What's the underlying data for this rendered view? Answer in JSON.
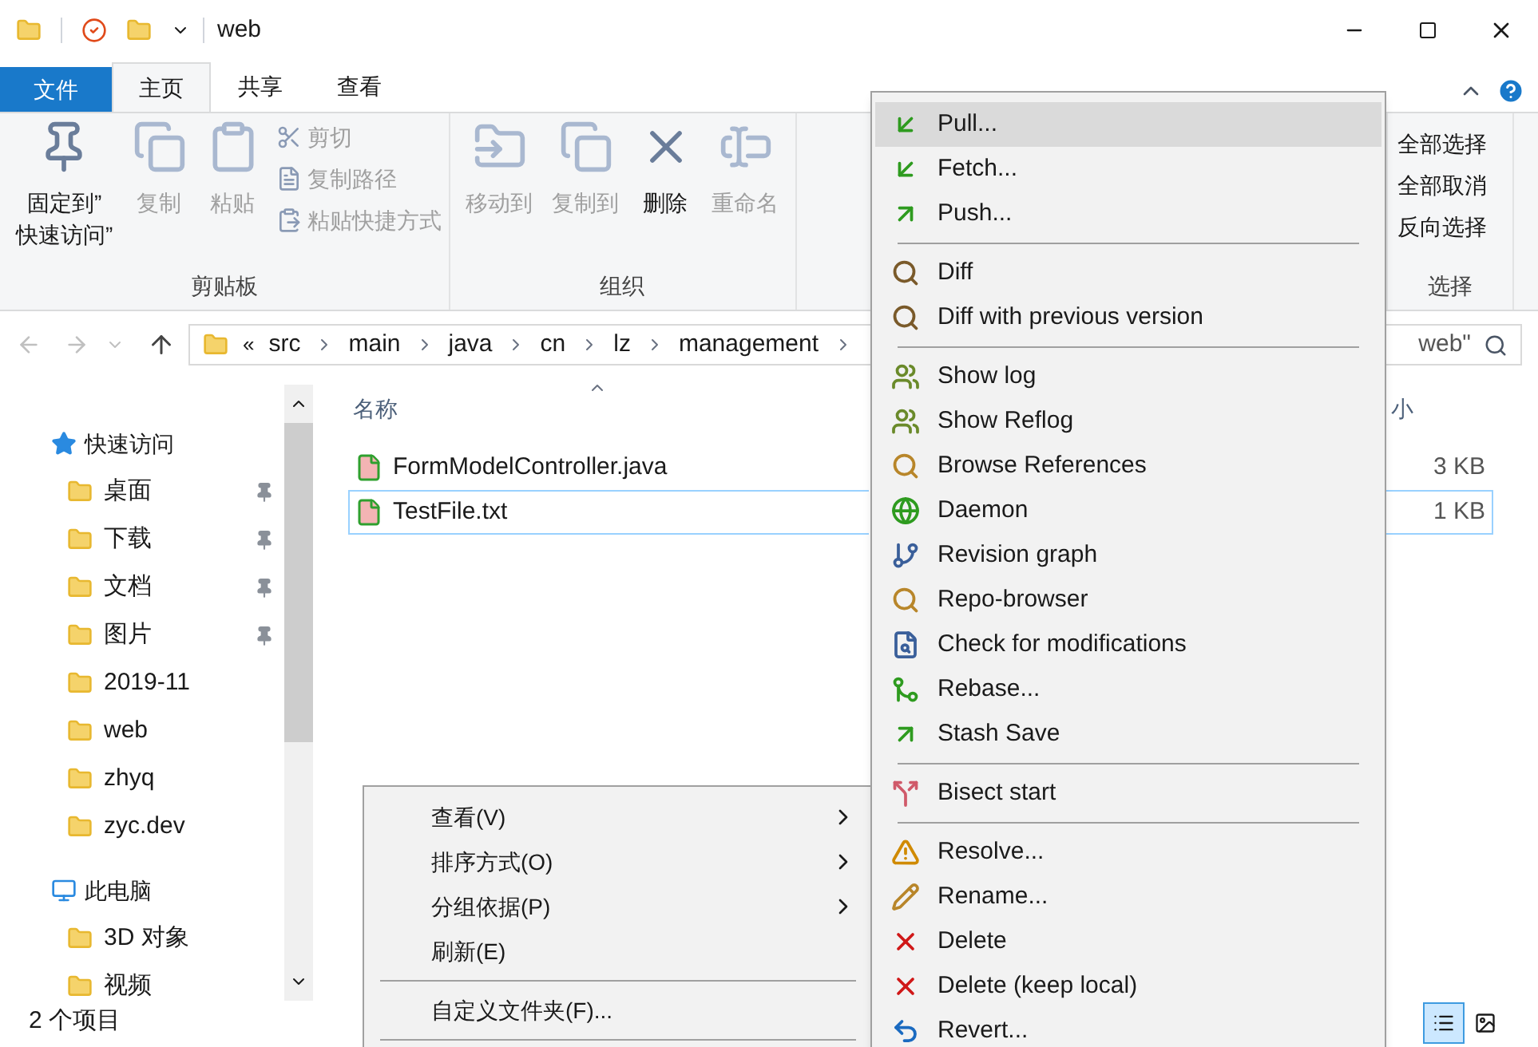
{
  "window": {
    "title": "web"
  },
  "ribbon_tabs": [
    {
      "label": "文件",
      "kind": "file",
      "selected": false
    },
    {
      "label": "主页",
      "kind": "tab",
      "selected": true
    },
    {
      "label": "共享",
      "kind": "tab",
      "selected": false
    },
    {
      "label": "查看",
      "kind": "tab",
      "selected": false
    }
  ],
  "ribbon_groups": [
    {
      "label": "剪贴板",
      "large": [
        {
          "label": "固定到”\n快速访问”",
          "disabled": false
        },
        {
          "label": "复制",
          "disabled": true
        },
        {
          "label": "粘贴",
          "disabled": true
        }
      ],
      "small": [
        {
          "label": "剪切",
          "disabled": true
        },
        {
          "label": "复制路径",
          "disabled": true
        },
        {
          "label": "粘贴快捷方式",
          "disabled": true
        }
      ]
    },
    {
      "label": "组织",
      "large": [
        {
          "label": "移动到",
          "disabled": true
        },
        {
          "label": "复制到",
          "disabled": true
        },
        {
          "label": "删除",
          "disabled": false
        },
        {
          "label": "重命名",
          "disabled": true
        }
      ]
    }
  ],
  "selection_group": {
    "label": "选择",
    "items": [
      "全部选择",
      "全部取消",
      "反向选择"
    ]
  },
  "address_bar": {
    "overflow": "«",
    "crumbs": [
      "src",
      "main",
      "java",
      "cn",
      "lz",
      "management"
    ]
  },
  "search": {
    "value": "web\""
  },
  "nav_pane": [
    {
      "label": "快速访问",
      "children": [
        {
          "label": "桌面",
          "pinned": true
        },
        {
          "label": "下载",
          "pinned": true
        },
        {
          "label": "文档",
          "pinned": true
        },
        {
          "label": "图片",
          "pinned": true
        },
        {
          "label": "2019-11",
          "pinned": false
        },
        {
          "label": "web",
          "pinned": false
        },
        {
          "label": "zhyq",
          "pinned": false
        },
        {
          "label": "zyc.dev",
          "pinned": false
        }
      ]
    },
    {
      "label": "此电脑",
      "children": [
        {
          "label": "3D 对象",
          "pinned": false
        },
        {
          "label": "视频",
          "pinned": false
        }
      ]
    }
  ],
  "file_list": {
    "columns": [
      "名称",
      "小"
    ],
    "rows": [
      {
        "name": "FormModelController.java",
        "size": "3 KB",
        "selected": false
      },
      {
        "name": "TestFile.txt",
        "size": "1 KB",
        "selected": true
      }
    ]
  },
  "status_bar": {
    "text": "2 个项目"
  },
  "context_menu": [
    {
      "kind": "item",
      "label": "查看(V)",
      "submenu": true
    },
    {
      "kind": "item",
      "label": "排序方式(O)",
      "submenu": true
    },
    {
      "kind": "item",
      "label": "分组依据(P)",
      "submenu": true
    },
    {
      "kind": "item",
      "label": "刷新(E)",
      "submenu": false
    },
    {
      "kind": "separator"
    },
    {
      "kind": "item",
      "label": "自定义文件夹(F)...",
      "submenu": false
    },
    {
      "kind": "separator"
    }
  ],
  "git_menu": [
    {
      "kind": "item",
      "label": "Pull...",
      "selected": true
    },
    {
      "kind": "item",
      "label": "Fetch...",
      "selected": false
    },
    {
      "kind": "item",
      "label": "Push...",
      "selected": false
    },
    {
      "kind": "separator"
    },
    {
      "kind": "item",
      "label": "Diff",
      "selected": false
    },
    {
      "kind": "item",
      "label": "Diff with previous version",
      "selected": false
    },
    {
      "kind": "separator"
    },
    {
      "kind": "item",
      "label": "Show log",
      "selected": false
    },
    {
      "kind": "item",
      "label": "Show Reflog",
      "selected": false
    },
    {
      "kind": "item",
      "label": "Browse References",
      "selected": false
    },
    {
      "kind": "item",
      "label": "Daemon",
      "selected": false
    },
    {
      "kind": "item",
      "label": "Revision graph",
      "selected": false
    },
    {
      "kind": "item",
      "label": "Repo-browser",
      "selected": false
    },
    {
      "kind": "item",
      "label": "Check for modifications",
      "selected": false
    },
    {
      "kind": "item",
      "label": "Rebase...",
      "selected": false
    },
    {
      "kind": "item",
      "label": "Stash Save",
      "selected": false
    },
    {
      "kind": "separator"
    },
    {
      "kind": "item",
      "label": "Bisect start",
      "selected": false
    },
    {
      "kind": "separator"
    },
    {
      "kind": "item",
      "label": "Resolve...",
      "selected": false
    },
    {
      "kind": "item",
      "label": "Rename...",
      "selected": false
    },
    {
      "kind": "item",
      "label": "Delete",
      "selected": false
    },
    {
      "kind": "item",
      "label": "Delete (keep local)",
      "selected": false
    },
    {
      "kind": "item",
      "label": "Revert...",
      "selected": false
    }
  ]
}
